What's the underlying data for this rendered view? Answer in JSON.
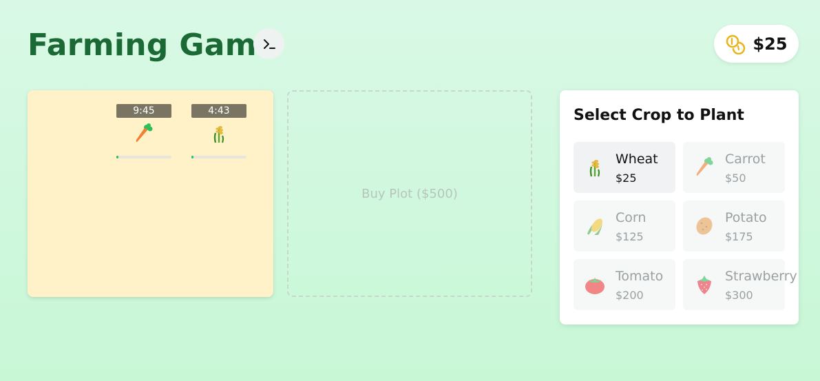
{
  "header": {
    "title": "Farming Game",
    "console_icon": "terminal-icon",
    "money": "$25",
    "money_icon": "coins-icon"
  },
  "plot": {
    "cells": [
      {
        "timer": "9:45",
        "crop": "carrot",
        "progress": 0.02
      },
      {
        "timer": "4:43",
        "crop": "wheat",
        "progress": 0.04
      }
    ]
  },
  "buy_plot": {
    "label": "Buy Plot ($500)"
  },
  "panel": {
    "title": "Select Crop to Plant",
    "crops": [
      {
        "name": "Wheat",
        "price": "$25",
        "icon": "wheat-icon",
        "selected": true
      },
      {
        "name": "Carrot",
        "price": "$50",
        "icon": "carrot-icon",
        "selected": false
      },
      {
        "name": "Corn",
        "price": "$125",
        "icon": "corn-icon",
        "selected": false
      },
      {
        "name": "Potato",
        "price": "$175",
        "icon": "potato-icon",
        "selected": false
      },
      {
        "name": "Tomato",
        "price": "$200",
        "icon": "tomato-icon",
        "selected": false
      },
      {
        "name": "Strawberry",
        "price": "$300",
        "icon": "strawberry-icon",
        "selected": false
      }
    ]
  },
  "colors": {
    "title": "#1b6a35",
    "plot_bg": "#fff2c8",
    "progress": "#2fbd64",
    "coin": "#e7b51d"
  }
}
